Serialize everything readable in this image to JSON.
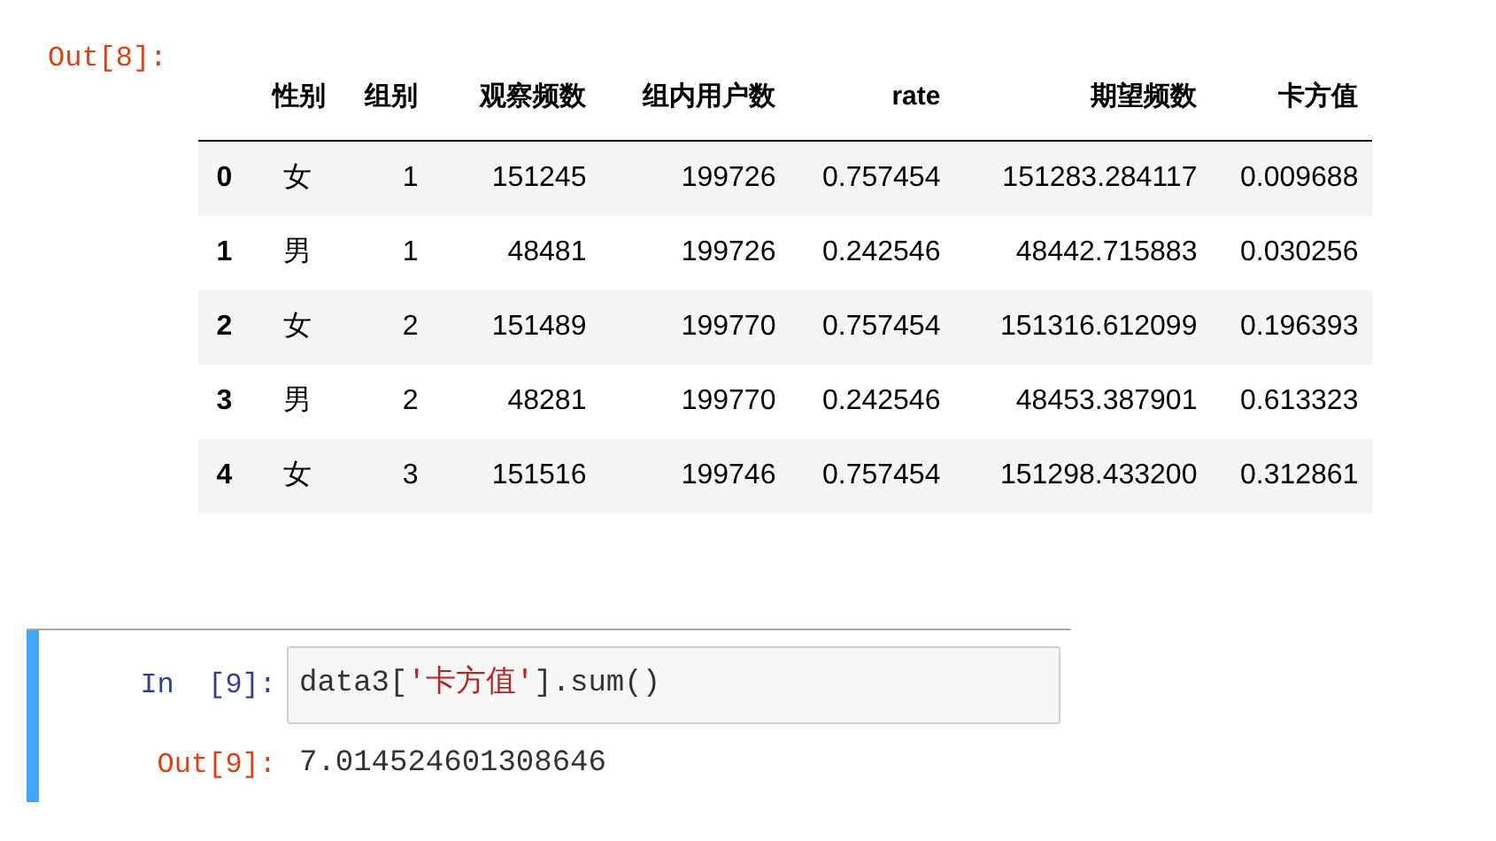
{
  "output_cell": {
    "prompt": "Out[8]:",
    "table": {
      "columns": [
        "",
        "性别",
        "组别",
        "观察频数",
        "组内用户数",
        "rate",
        "期望频数",
        "卡方值"
      ],
      "rows": [
        [
          "0",
          "女",
          "1",
          "151245",
          "199726",
          "0.757454",
          "151283.284117",
          "0.009688"
        ],
        [
          "1",
          "男",
          "1",
          "48481",
          "199726",
          "0.242546",
          "48442.715883",
          "0.030256"
        ],
        [
          "2",
          "女",
          "2",
          "151489",
          "199770",
          "0.757454",
          "151316.612099",
          "0.196393"
        ],
        [
          "3",
          "男",
          "2",
          "48281",
          "199770",
          "0.242546",
          "48453.387901",
          "0.613323"
        ],
        [
          "4",
          "女",
          "3",
          "151516",
          "199746",
          "0.757454",
          "151298.433200",
          "0.312861"
        ]
      ]
    }
  },
  "code_cell": {
    "selected": true,
    "in_prompt": "In  [9]:",
    "code": [
      {
        "kind": "plain",
        "text": "data3["
      },
      {
        "kind": "string",
        "text": "'卡方值'"
      },
      {
        "kind": "plain",
        "text": "].sum()"
      }
    ],
    "out_prompt": "Out[9]:",
    "output": "7.014524601308646"
  }
}
